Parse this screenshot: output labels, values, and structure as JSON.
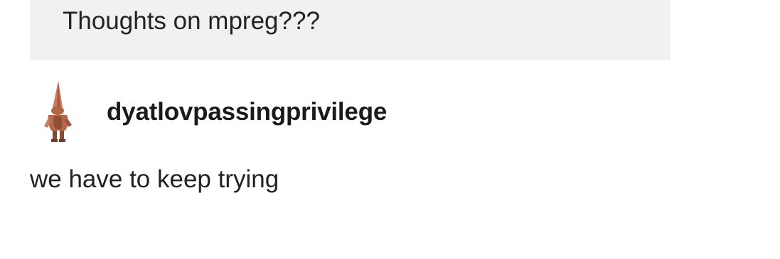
{
  "ask": {
    "question": "Thoughts on mpreg???"
  },
  "answer": {
    "avatar_icon": "gnome-figure-avatar-icon",
    "username": "dyatlovpassingprivilege",
    "text": "we have to keep trying"
  },
  "colors": {
    "ask_background": "#f1f1f1",
    "page_background": "#ffffff",
    "avatar_primary": "#b5694a"
  }
}
